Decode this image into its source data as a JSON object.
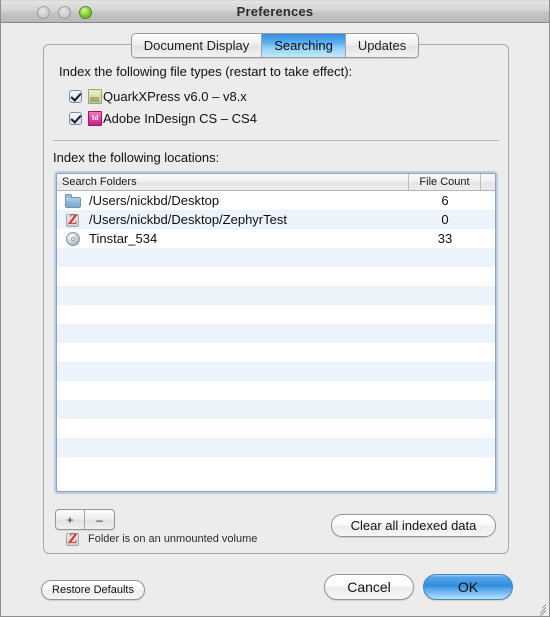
{
  "window": {
    "title": "Preferences",
    "traffic_lights": [
      "close",
      "minimize",
      "zoom"
    ]
  },
  "tabs": [
    {
      "label": "Document Display",
      "active": false
    },
    {
      "label": "Searching",
      "active": true
    },
    {
      "label": "Updates",
      "active": false
    }
  ],
  "filetypes": {
    "label": "Index the following file types (restart to take effect):",
    "items": [
      {
        "label": "QuarkXPress v6.0 – v8.x",
        "checked": true,
        "icon": "quarkxpress-document-icon"
      },
      {
        "label": "Adobe InDesign CS – CS4",
        "checked": true,
        "icon": "indesign-document-icon",
        "glyph": "Id"
      }
    ]
  },
  "locations": {
    "label": "Index the following locations:",
    "columns": [
      "Search Folders",
      "File Count"
    ],
    "rows": [
      {
        "name": "/Users/nickbd/Desktop",
        "count": "6",
        "icon": "folder-icon"
      },
      {
        "name": "/Users/nickbd/Desktop/ZephyrTest",
        "count": "0",
        "icon": "unmounted-volume-icon"
      },
      {
        "name": "Tinstar_534",
        "count": "33",
        "icon": "disc-icon"
      }
    ],
    "empty_row_count": 12
  },
  "controls": {
    "add_label": "+",
    "remove_label": "–",
    "legend_text": "Folder is on an unmounted volume",
    "clear_label": "Clear all indexed data",
    "restore_label": "Restore Defaults",
    "cancel_label": "Cancel",
    "ok_label": "OK"
  },
  "colors": {
    "accent_blue": "#2f8cdf",
    "tab_active": "#64b2f0",
    "row_stripe": "#edf3fb",
    "unmounted_red": "#d4302c",
    "indesign_magenta": "#e0429f",
    "folder_blue": "#8fb6d6"
  }
}
